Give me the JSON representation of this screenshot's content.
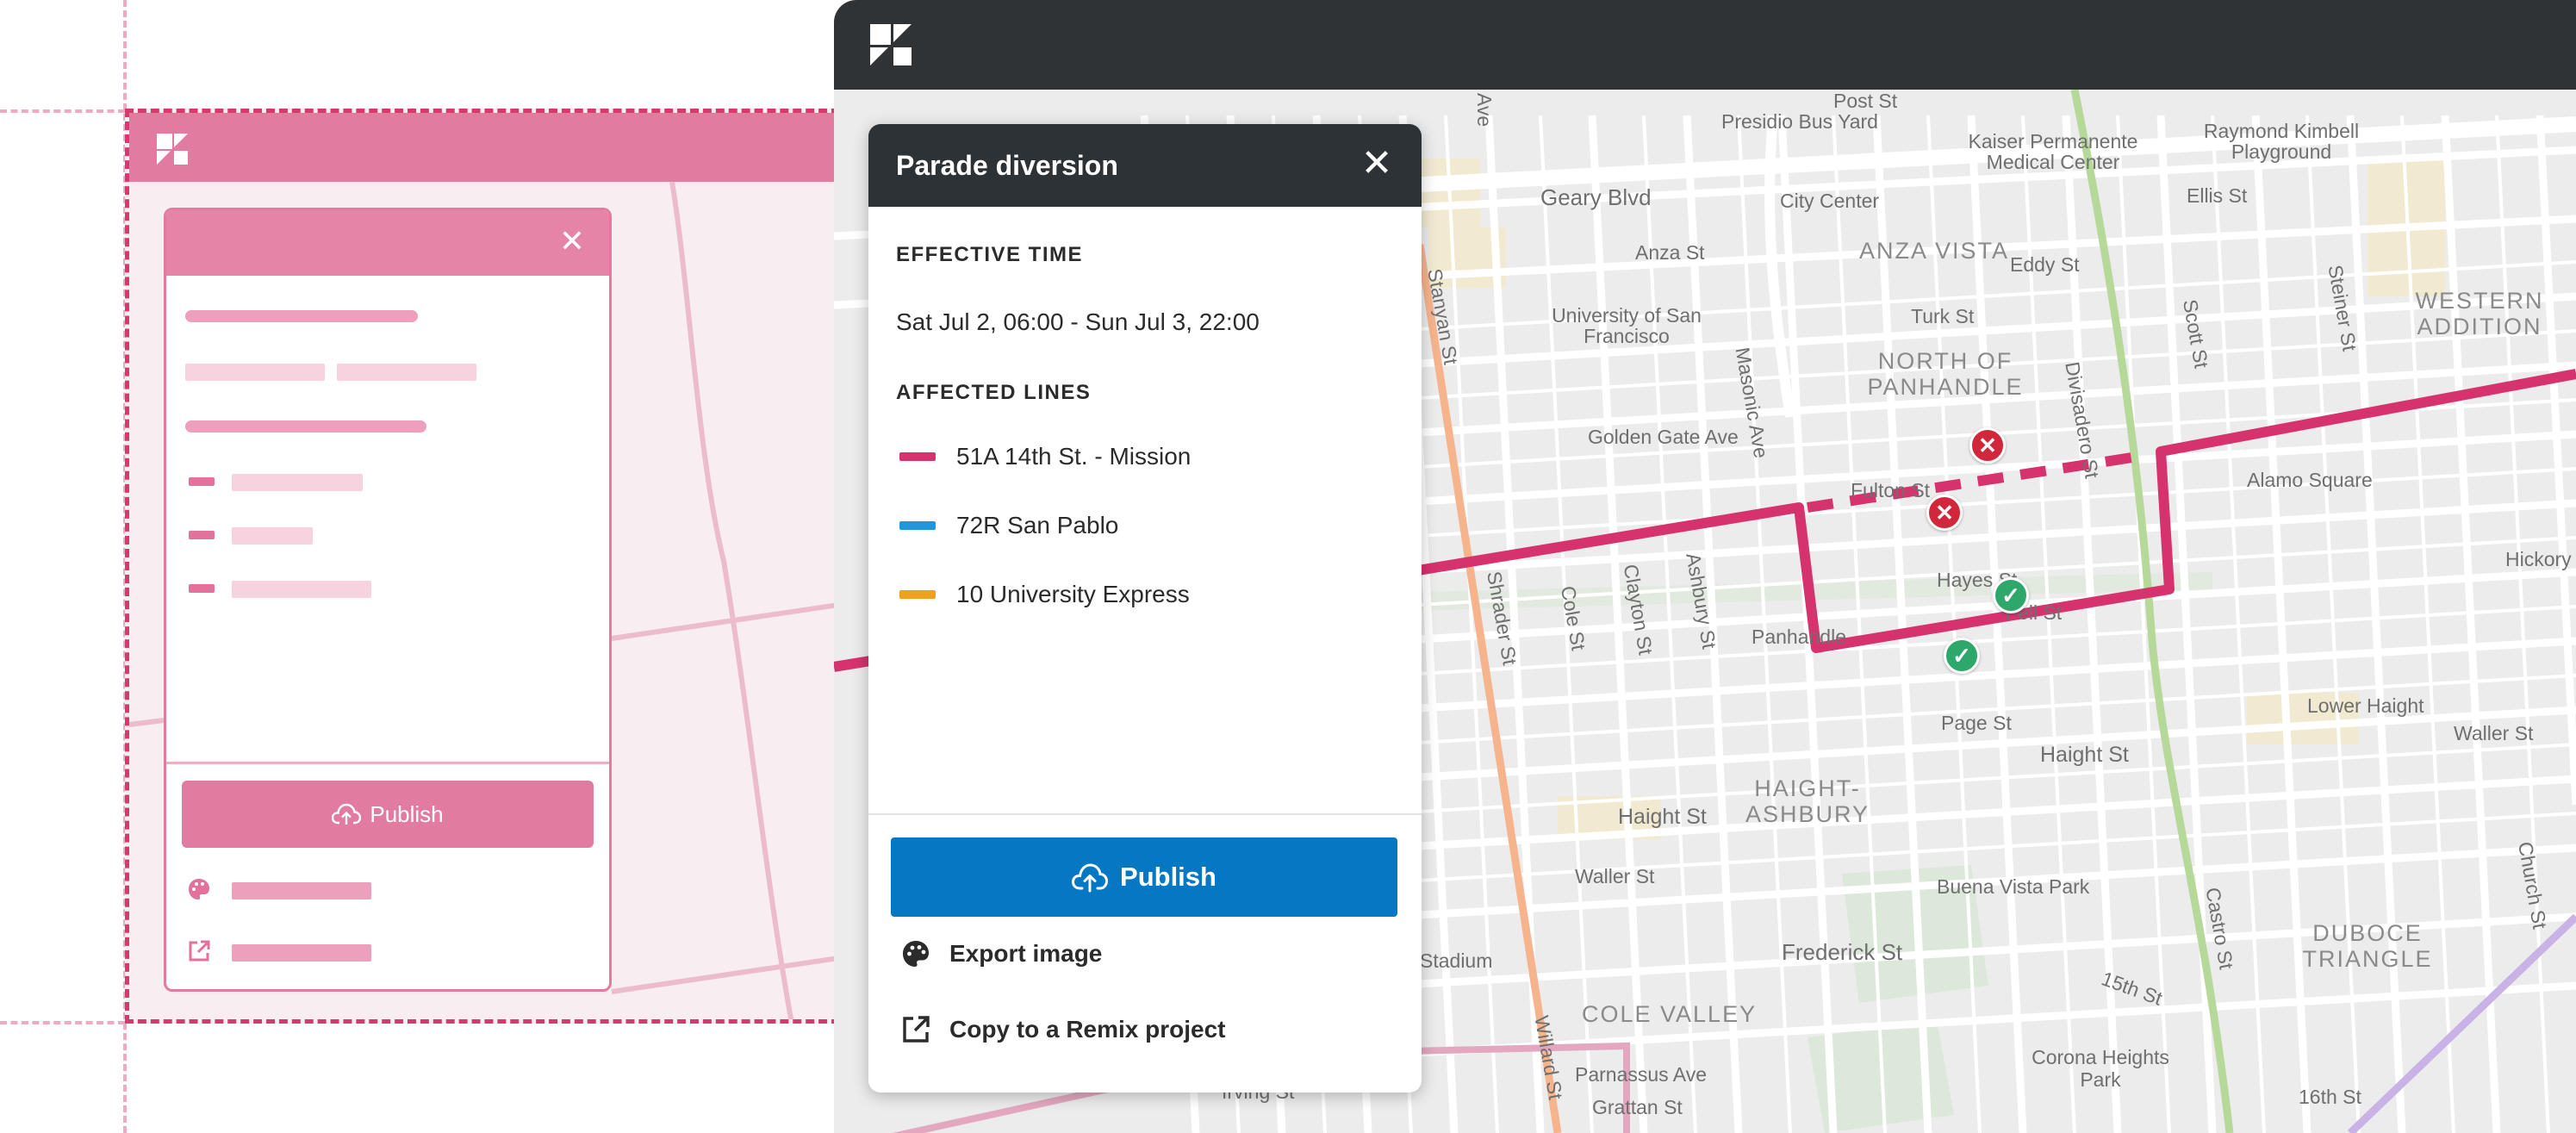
{
  "wireframe": {
    "publish_label": "Publish",
    "close_glyph": "✕",
    "colors": {
      "frame": "#d63a6d",
      "fill": "#e27ba0",
      "light": "#f6d3df"
    }
  },
  "app": {
    "logo": "remix-logo-icon",
    "header_color": "#303336"
  },
  "panel": {
    "title": "Parade diversion",
    "close_glyph": "✕",
    "effective_time": {
      "heading": "EFFECTIVE TIME",
      "value": "Sat Jul 2, 06:00 - Sun Jul 3, 22:00"
    },
    "affected_lines": {
      "heading": "AFFECTED LINES",
      "lines": [
        {
          "label": "51A 14th St. - Mission",
          "color": "#d5326e"
        },
        {
          "label": "72R San Pablo",
          "color": "#1f96e0"
        },
        {
          "label": "10 University Express",
          "color": "#f0a11c"
        }
      ]
    },
    "publish_label": "Publish",
    "actions": [
      {
        "label": "Export image",
        "icon": "palette-icon"
      },
      {
        "label": "Copy to a Remix project",
        "icon": "external-link-icon"
      }
    ]
  },
  "map": {
    "streets": [
      "Post St",
      "Presidio Bus Yard",
      "Kaiser Permanente Medical Center",
      "Raymond Kimbell Playground",
      "Geary Blvd",
      "City Center",
      "Ellis St",
      "Anza St",
      "Eddy St",
      "Turk St",
      "University of San Francisco",
      "Scott St",
      "Steiner St",
      "Masonic Ave",
      "Divisadero St",
      "Golden Gate Ave",
      "Fulton St",
      "Alamo Square",
      "Hickory",
      "Shrader St",
      "Cole St",
      "Clayton St",
      "Ashbury St",
      "Hayes St",
      "Fell St",
      "Panhandle",
      "Page St",
      "Lower Haight",
      "Waller St",
      "Haight St",
      "Buena Vista Park",
      "Castro St",
      "Church St",
      "Frederick St",
      "Stadium",
      "15th St",
      "Willard St",
      "Parnassus Ave",
      "Corona Heights Park",
      "Grattan St",
      "16th St",
      "Irving St",
      "Stanyan St",
      "Ave"
    ],
    "areas": [
      "ANZA VISTA",
      "NORTH OF PANHANDLE",
      "WESTERN ADDITION",
      "HAIGHT-ASHBURY",
      "COLE VALLEY",
      "DUBOCE TRIANGLE"
    ],
    "markers": {
      "closed": "✕",
      "open": "✓"
    }
  }
}
